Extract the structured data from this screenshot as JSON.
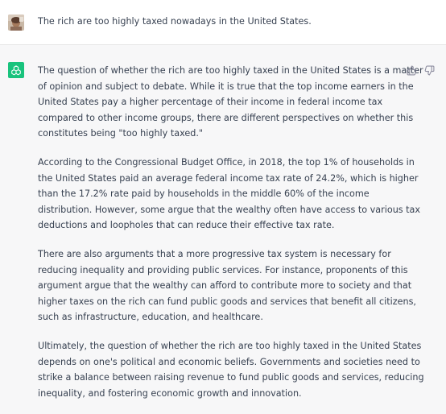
{
  "user_message": {
    "text": "The rich are too highly taxed nowadays in the United States."
  },
  "assistant_message": {
    "paragraphs": [
      {
        "lines": [
          "The question of whether the rich are too highly taxed in the United States is a matter",
          "of opinion and subject to debate. While it is true that the top income earners in the",
          "United States pay a higher percentage of their income in federal income tax",
          "compared to other income groups, there are different perspectives on whether this",
          "constitutes being \"too highly taxed.\""
        ]
      },
      {
        "lines": [
          "According to the Congressional Budget Office, in 2018, the top 1% of households in",
          "the United States paid an average federal income tax rate of 24.2%, which is higher",
          "than the 17.2% rate paid by households in the middle 60% of the income",
          "distribution. However, some argue that the wealthy often have access to various tax",
          "deductions and loopholes that can reduce their effective tax rate."
        ]
      },
      {
        "lines": [
          "There are also arguments that a more progressive tax system is necessary for",
          "reducing inequality and providing public services. For instance, proponents of this",
          "argument argue that the wealthy can afford to contribute more to society and that",
          "higher taxes on the rich can fund public goods and services that benefit all citizens,",
          "such as infrastructure, education, and healthcare."
        ]
      },
      {
        "lines": [
          "Ultimately, the question of whether the rich are too highly taxed in the United States",
          "depends on one's political and economic beliefs. Governments and societies need to",
          "strike a balance between raising revenue to fund public goods and services, reducing",
          "inequality, and fostering economic growth and innovation."
        ]
      }
    ]
  },
  "icons": {
    "avatar": "user-avatar",
    "assistant": "chatgpt-logo-icon",
    "thumbs_up": "thumbs-up-icon",
    "thumbs_down": "thumbs-down-icon"
  },
  "colors": {
    "accent": "#19c37d",
    "text": "#374151",
    "assistant_bg": "#f7f7f8",
    "user_bg": "#ffffff"
  }
}
